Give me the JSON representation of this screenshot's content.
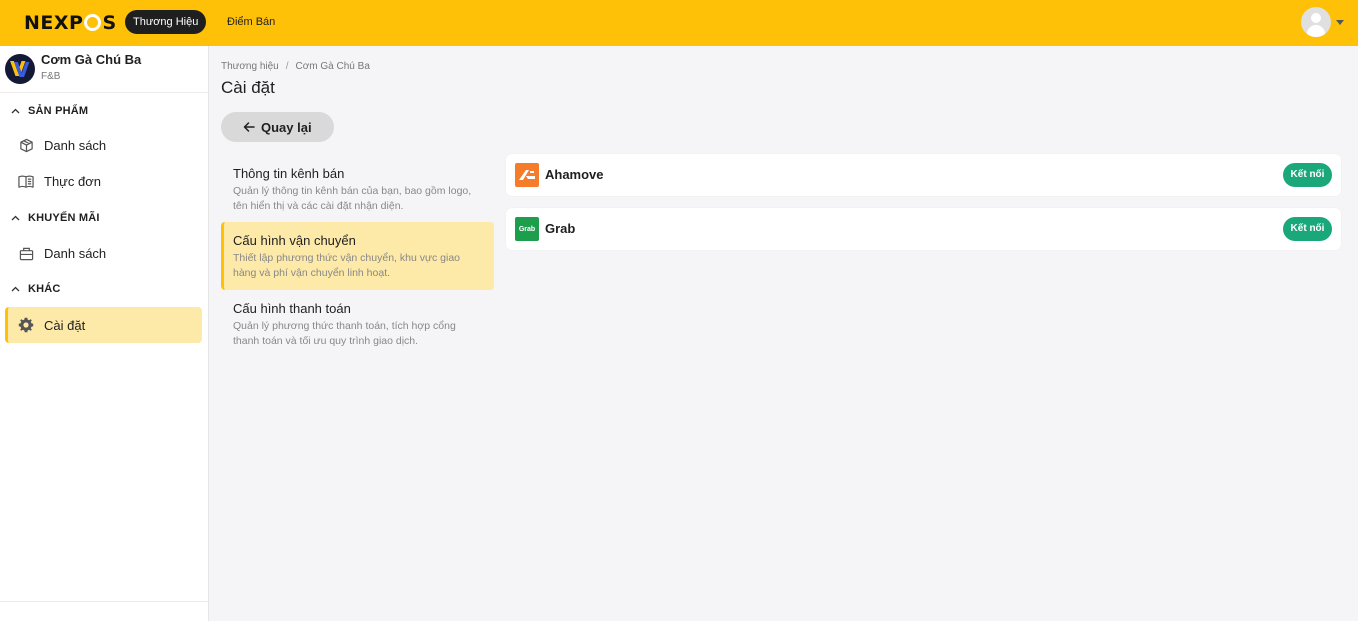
{
  "topbar": {
    "logo_text": "NEXPOS",
    "nav": [
      {
        "label": "Thương Hiệu",
        "active": true
      },
      {
        "label": "Điểm Bán",
        "active": false
      }
    ]
  },
  "sidebar": {
    "brand": {
      "name": "Cơm Gà Chú Ba",
      "category": "F&B"
    },
    "sections": [
      {
        "title": "SẢN PHẨM",
        "items": [
          {
            "label": "Danh sách",
            "icon": "package-icon"
          },
          {
            "label": "Thực đơn",
            "icon": "menu-book-icon"
          }
        ]
      },
      {
        "title": "KHUYẾN MÃI",
        "items": [
          {
            "label": "Danh sách",
            "icon": "gift-box-icon"
          }
        ]
      },
      {
        "title": "KHÁC",
        "items": [
          {
            "label": "Cài đặt",
            "icon": "gear-icon",
            "active": true
          }
        ]
      }
    ]
  },
  "breadcrumb": [
    "Thương hiệu",
    "Cơm Gà Chú Ba"
  ],
  "page_title": "Cài đặt",
  "back_button": "Quay lại",
  "settings_menu": [
    {
      "title": "Thông tin kênh bán",
      "desc": "Quản lý thông tin kênh bán của bạn, bao gồm logo, tên hiển thị và các cài đặt nhận diện."
    },
    {
      "title": "Cấu hình vận chuyển",
      "desc": "Thiết lập phương thức vận chuyển, khu vực giao hàng và phí vận chuyển linh hoạt.",
      "active": true
    },
    {
      "title": "Cấu hình thanh toán",
      "desc": "Quản lý phương thức thanh toán, tích hợp cổng thanh toán và tối ưu quy trình giao dịch."
    }
  ],
  "providers": [
    {
      "name": "Ahamove",
      "button": "Kết nối",
      "logo": "ahamove-logo-icon"
    },
    {
      "name": "Grab",
      "logo_text": "Grab",
      "button": "Kết nối",
      "logo": "grab-logo-icon"
    }
  ],
  "colors": {
    "accent": "#ffc107",
    "active_bg": "#fde9a8",
    "connect": "#1aa779"
  }
}
